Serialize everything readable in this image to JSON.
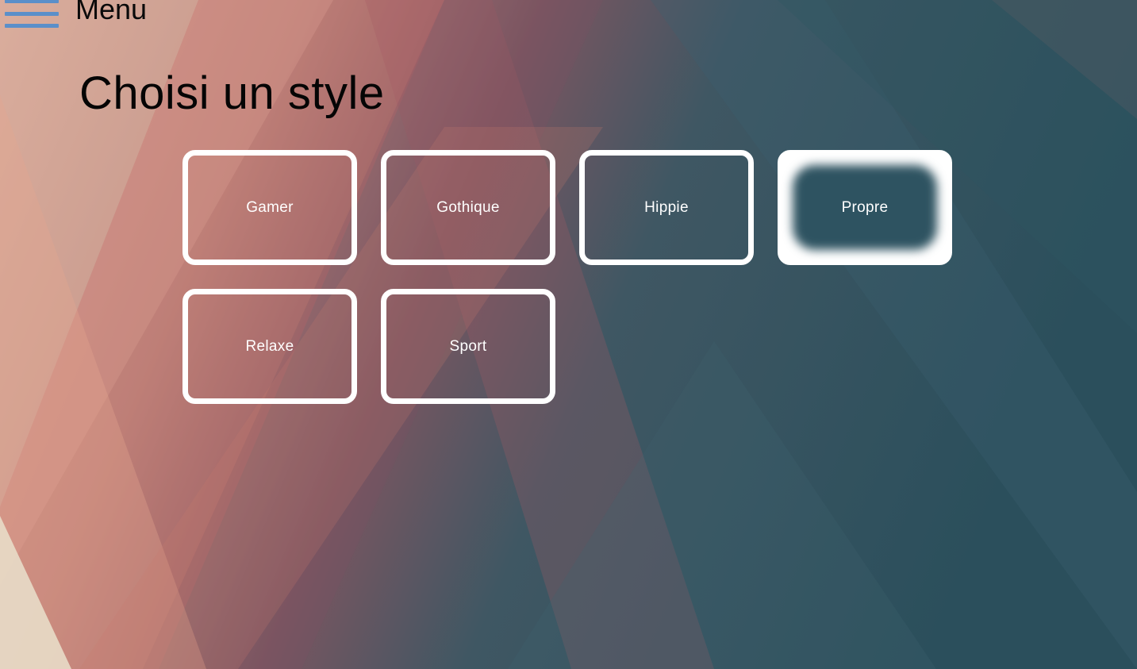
{
  "menu": {
    "label": "Menu",
    "icon": "hamburger-icon"
  },
  "page": {
    "title": "Choisi un style"
  },
  "styles": [
    {
      "label": "Gamer",
      "selected": false
    },
    {
      "label": "Gothique",
      "selected": false
    },
    {
      "label": "Hippie",
      "selected": false
    },
    {
      "label": "Propre",
      "selected": true
    },
    {
      "label": "Relaxe",
      "selected": false
    },
    {
      "label": "Sport",
      "selected": false
    }
  ],
  "colors": {
    "accent_menu_icon": "#5b8fc9",
    "card_border": "#ffffff",
    "background_dark": "#2c4f5c",
    "background_warm": "#c98a7e"
  }
}
